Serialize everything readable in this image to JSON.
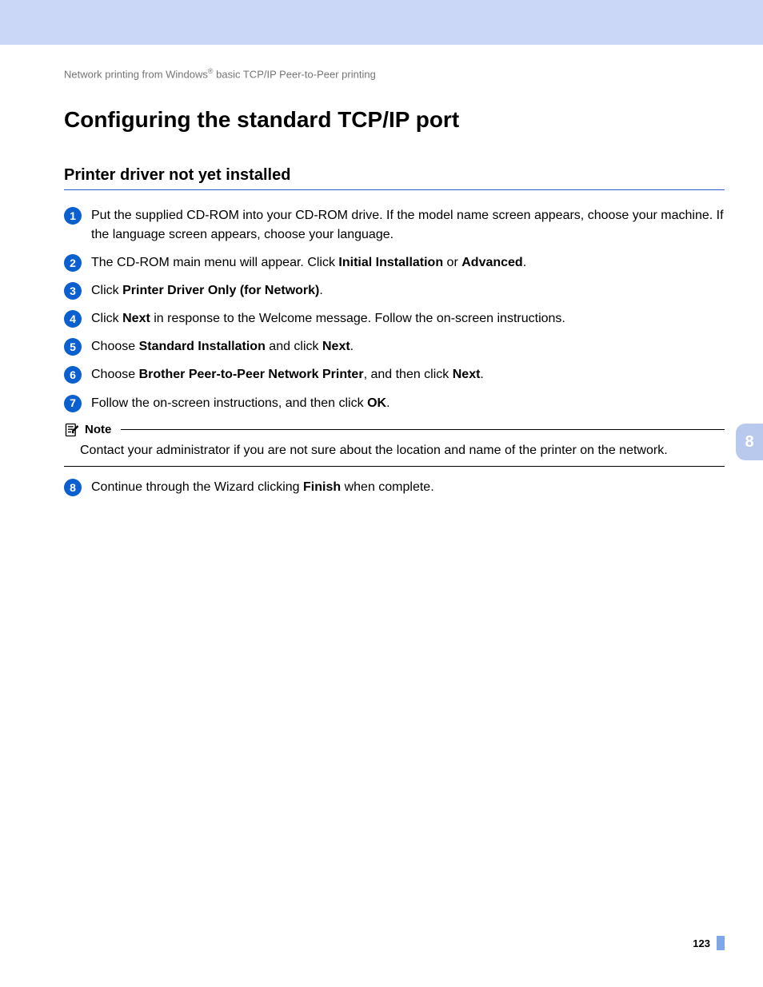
{
  "header": {
    "breadcrumb_pre": "Network printing from Windows",
    "breadcrumb_sup": "®",
    "breadcrumb_post": " basic TCP/IP Peer-to-Peer printing"
  },
  "title": "Configuring the standard TCP/IP port",
  "subtitle": "Printer driver not yet installed",
  "steps": [
    {
      "n": "1",
      "html": "Put the supplied CD-ROM into your CD-ROM drive. If the model name screen appears, choose your machine. If the language screen appears, choose your language."
    },
    {
      "n": "2",
      "html": "The CD-ROM main menu will appear. Click <b>Initial Installation</b> or <b>Advanced</b>."
    },
    {
      "n": "3",
      "html": "Click <b>Printer Driver Only (for Network)</b>."
    },
    {
      "n": "4",
      "html": "Click <b>Next</b> in response to the Welcome message. Follow the on-screen instructions."
    },
    {
      "n": "5",
      "html": "Choose <b>Standard Installation</b> and click <b>Next</b>."
    },
    {
      "n": "6",
      "html": "Choose <b>Brother Peer-to-Peer Network Printer</b>, and then click <b>Next</b>."
    },
    {
      "n": "7",
      "html": "Follow the on-screen instructions, and then click <b>OK</b>."
    }
  ],
  "note": {
    "label": "Note",
    "body": "Contact your administrator if you are not sure about the location and name of the printer on the network."
  },
  "steps_after": [
    {
      "n": "8",
      "html": "Continue through the Wizard clicking <b>Finish</b> when complete."
    }
  ],
  "side_tab": "8",
  "page_number": "123"
}
